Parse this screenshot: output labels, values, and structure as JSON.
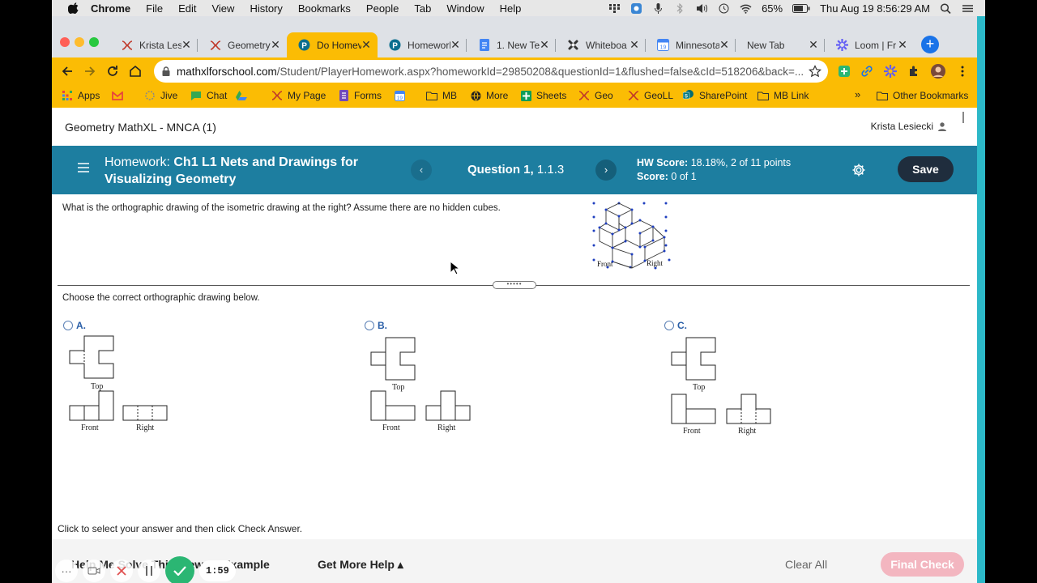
{
  "menubar": {
    "app": "Chrome",
    "items": [
      "File",
      "Edit",
      "View",
      "History",
      "Bookmarks",
      "People",
      "Tab",
      "Window",
      "Help"
    ],
    "battery": "65%",
    "clock": "Thu Aug 19  8:56:29 AM"
  },
  "tabs": [
    {
      "label": "Krista Les",
      "icon": "x-logo-icon",
      "color": "#c0392b"
    },
    {
      "label": "Geometry",
      "icon": "x-logo-icon",
      "color": "#c0392b"
    },
    {
      "label": "Do Homev",
      "icon": "pearson-p-icon",
      "color": "#0b6e8e",
      "active": true
    },
    {
      "label": "Homework",
      "icon": "pearson-p-icon",
      "color": "#0b6e8e"
    },
    {
      "label": "1. New Te",
      "icon": "docs-icon",
      "color": "#4285f4"
    },
    {
      "label": "Whiteboa",
      "icon": "whiteboard-icon",
      "color": "#333333"
    },
    {
      "label": "Minnesota",
      "icon": "calendar-icon",
      "color": "#4285f4"
    },
    {
      "label": "New Tab",
      "icon": "",
      "color": ""
    },
    {
      "label": "Loom | Fr",
      "icon": "loom-icon",
      "color": "#625df5"
    }
  ],
  "omnibox": {
    "host": "mathxlforschool.com",
    "path": "/Student/PlayerHomework.aspx?homeworkId=29850208&questionId=1&flushed=false&cId=518206&back=..."
  },
  "bookmarks": [
    {
      "label": "Apps",
      "icon": "apps-grid-icon"
    },
    {
      "label": "",
      "icon": "gmail-icon"
    },
    {
      "label": "Jive",
      "icon": "jive-icon"
    },
    {
      "label": "Chat",
      "icon": "chat-icon"
    },
    {
      "label": "",
      "icon": "drive-icon"
    },
    {
      "label": "My Page",
      "icon": "x-logo-icon"
    },
    {
      "label": "Forms",
      "icon": "forms-icon"
    },
    {
      "label": "",
      "icon": "calendar-icon"
    },
    {
      "label": "MB",
      "icon": "folder-icon"
    },
    {
      "label": "More",
      "icon": "globe-icon"
    },
    {
      "label": "Sheets",
      "icon": "sheets-icon"
    },
    {
      "label": "Geo",
      "icon": "x-logo-icon"
    },
    {
      "label": "GeoLL",
      "icon": "x-logo-icon"
    },
    {
      "label": "SharePoint",
      "icon": "sharepoint-icon"
    },
    {
      "label": "MB Link",
      "icon": "folder-icon"
    }
  ],
  "bookmarks_overflow": "»",
  "other_bookmarks": "Other Bookmarks",
  "page": {
    "course_title": "Geometry MathXL - MNCA (1)",
    "user_name": "Krista Lesiecki",
    "homework_label": "Homework:",
    "homework_name": "Ch1 L1 Nets and Drawings for Visualizing Geometry",
    "question_label": "Question 1,",
    "question_number": "1.1.3",
    "hw_score_label": "HW Score:",
    "hw_score_value": "18.18%, 2 of 11 points",
    "score_label": "Score:",
    "score_value": "0 of 1",
    "save_label": "Save",
    "prev_glyph": "‹",
    "next_glyph": "›",
    "splitter_glyph": "•••••",
    "question_text": "What is the orthographic drawing of the isometric drawing at the right? Assume there are no hidden cubes.",
    "iso_front_label": "Front",
    "iso_right_label": "Right",
    "choose_text": "Choose the correct orthographic drawing below.",
    "choices": [
      {
        "letter": "A.",
        "top": "Top",
        "front": "Front",
        "right": "Right"
      },
      {
        "letter": "B.",
        "top": "Top",
        "front": "Front",
        "right": "Right"
      },
      {
        "letter": "C.",
        "top": "Top",
        "front": "Front",
        "right": "Right"
      }
    ],
    "instructions": "Click to select your answer and then click Check Answer.",
    "view_example": "Help Me Solve This   View an Example",
    "get_more_help": "Get More Help ▴",
    "clear_all": "Clear All",
    "final_check": "Final Check"
  },
  "recorder": {
    "time": "1:59"
  },
  "colors": {
    "active_tab": "#fbbc04",
    "header_bar": "#1d7ea0",
    "save_button": "#1f2d3d",
    "final_check": "#f3b6c0",
    "choice_letter": "#2a5fa8"
  }
}
